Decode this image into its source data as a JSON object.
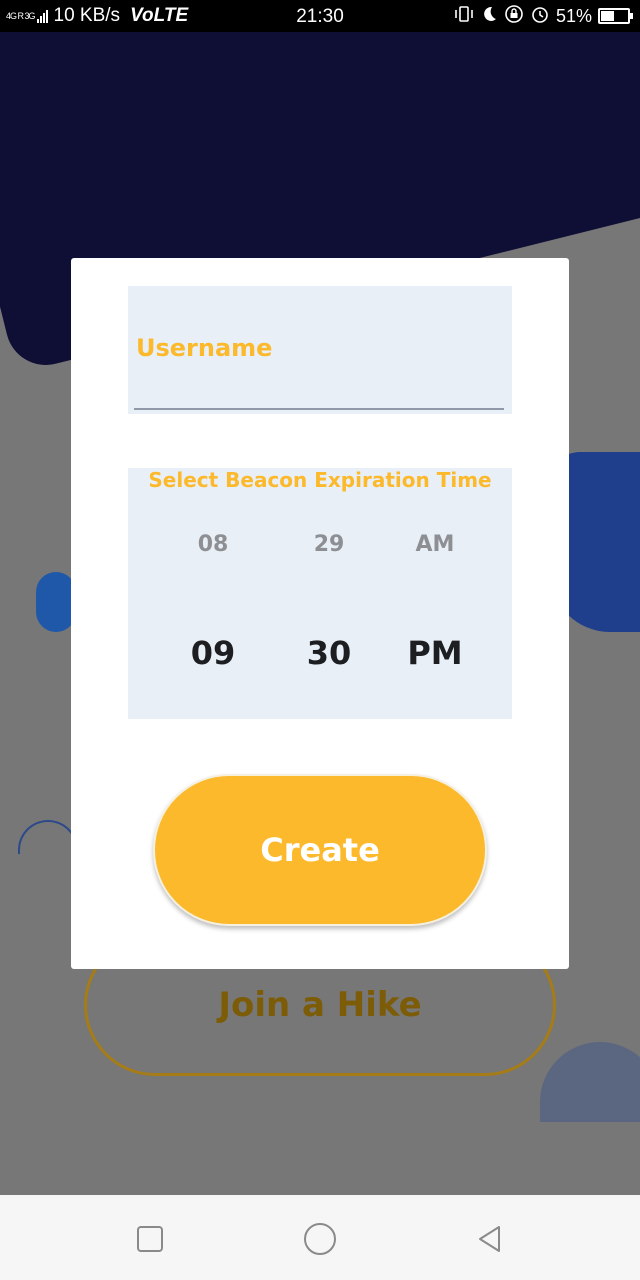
{
  "status_bar": {
    "network": "4G R 3G",
    "speed": "10 KB/s",
    "volte": "VoLTE",
    "time": "21:30",
    "battery": "51%",
    "battery_level": 0.51,
    "icons": [
      "vibrate-icon",
      "moon-icon",
      "rotation-lock-icon",
      "alarm-icon",
      "battery-icon"
    ]
  },
  "background": {
    "join_label": "Join a Hike"
  },
  "dialog": {
    "username_label": "Username",
    "username_value": "",
    "time_title": "Select Beacon Expiration Time",
    "picker": {
      "hour_prev": "08",
      "minute_prev": "29",
      "ampm_prev": "AM",
      "hour": "09",
      "minute": "30",
      "ampm": "PM"
    },
    "create_label": "Create"
  },
  "colors": {
    "accent": "#fbb92b",
    "field_bg": "#e8eff7",
    "scrim": "#777777",
    "dark_shape": "#0f0e35"
  },
  "nav": {
    "icons": [
      "recent-apps-icon",
      "home-icon",
      "back-icon"
    ]
  }
}
